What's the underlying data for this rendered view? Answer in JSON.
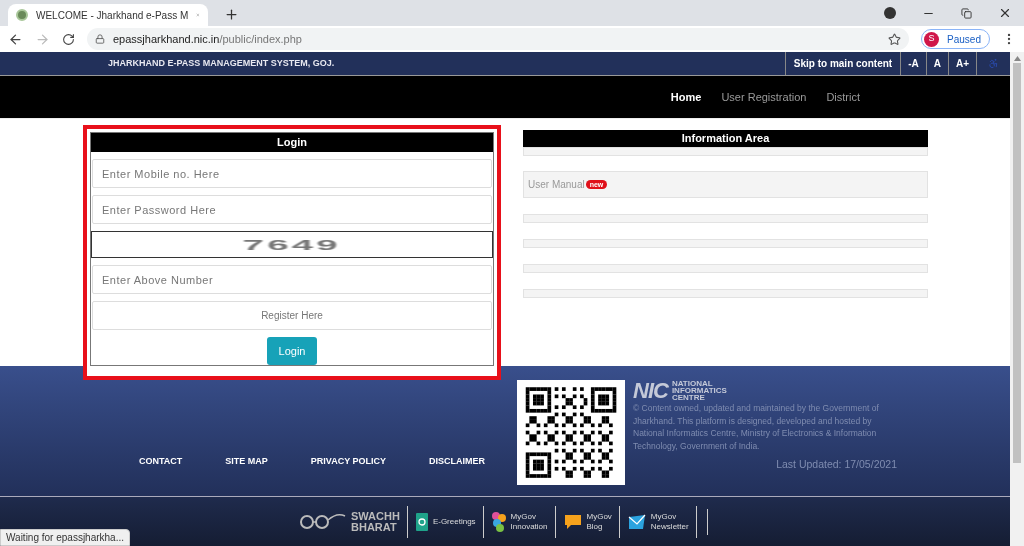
{
  "browser": {
    "tab_title": "WELCOME - Jharkhand e-Pass M",
    "url_host": "epassjharkhand.nic.in",
    "url_path": "/public/index.php",
    "profile_initial": "S",
    "profile_status": "Paused",
    "status": "Waiting for epassjharkha..."
  },
  "header": {
    "title": "JHARKHAND E-PASS MANAGEMENT SYSTEM, GOJ.",
    "skip_link": "Skip to main content",
    "font_buttons": [
      "-A",
      "A",
      "A+"
    ]
  },
  "nav": [
    {
      "label": "Home",
      "selected": true
    },
    {
      "label": "User Registration",
      "selected": false
    },
    {
      "label": "District",
      "selected": false
    }
  ],
  "login": {
    "title": "Login",
    "highlighted": true,
    "fields": [
      {
        "placeholder": "Enter Mobile no. Here"
      },
      {
        "placeholder": "Enter Password Here"
      }
    ],
    "captcha": "7649",
    "captcha_field": {
      "placeholder": "Enter Above Number"
    },
    "register": "Register Here",
    "button": "Login"
  },
  "info": {
    "title": "Information Area",
    "rows": [
      {
        "kind": "blank"
      },
      {
        "kind": "link",
        "label": "User Manual",
        "badge": "new"
      },
      {
        "kind": "blank"
      },
      {
        "kind": "blank"
      },
      {
        "kind": "blank"
      },
      {
        "kind": "blank"
      }
    ]
  },
  "footer": {
    "links": [
      "CONTACT",
      "SITE MAP",
      "PRIVACY POLICY",
      "DISCLAIMER"
    ],
    "nic_logo": "NIC",
    "nic_name": [
      "NATIONAL",
      "INFORMATICS",
      "CENTRE"
    ],
    "notice": "© Content owned, updated and maintained by the Government of Jharkhand. This platform is designed, developed and hosted by National Informatics Centre, Ministry of Electronics & Information Technology, Government of India.",
    "last_updated": "Last Updated: 17/05/2021"
  },
  "partners": [
    {
      "kind": "swachh",
      "lines": [
        "SWACHH",
        "BHARAT"
      ]
    },
    {
      "kind": "egreetings",
      "lines": [
        "E-Greetings"
      ]
    },
    {
      "kind": "innovation",
      "lines": [
        "MyGov",
        "Innovation"
      ]
    },
    {
      "kind": "blog",
      "lines": [
        "MyGov",
        "Blog"
      ]
    },
    {
      "kind": "newsletter",
      "lines": [
        "MyGov",
        "Newsletter"
      ]
    }
  ]
}
